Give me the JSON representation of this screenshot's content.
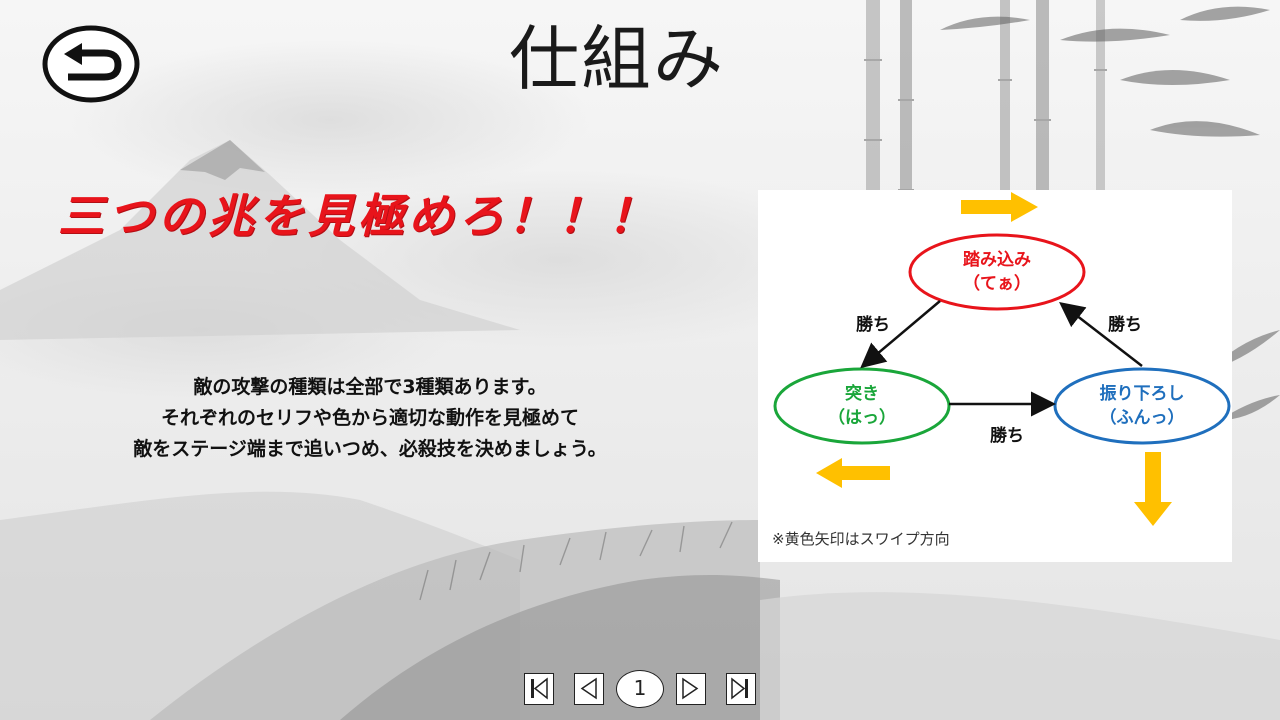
{
  "slide": {
    "title": "仕組み",
    "headline": "三つの兆を見極めろ！！！",
    "description_lines": [
      "敵の攻撃の種類は全部で3種類あります。",
      "それぞれのセリフや色から適切な動作を見極めて",
      "敵をステージ端まで追いつめ、必殺技を決めましょう。"
    ]
  },
  "diagram": {
    "nodes": {
      "top": {
        "line1": "踏み込み",
        "line2": "（てぁ）",
        "color": "#e8141b"
      },
      "left": {
        "line1": "突き",
        "line2": "（はっ）",
        "color": "#1aa63a"
      },
      "right": {
        "line1": "振り下ろし",
        "line2": "（ふんっ）",
        "color": "#1f6fbd"
      }
    },
    "edge_labels": {
      "top_left": "勝ち",
      "top_right": "勝ち",
      "bottom": "勝ち"
    },
    "swipe_arrow_color": "#ffc000",
    "caption": "※黄色矢印はスワイプ方向"
  },
  "navigation": {
    "back_icon": "return-arrow-icon",
    "first_icon": "skip-first-icon",
    "prev_icon": "previous-icon",
    "next_icon": "next-icon",
    "last_icon": "skip-last-icon",
    "page_number": "1"
  }
}
